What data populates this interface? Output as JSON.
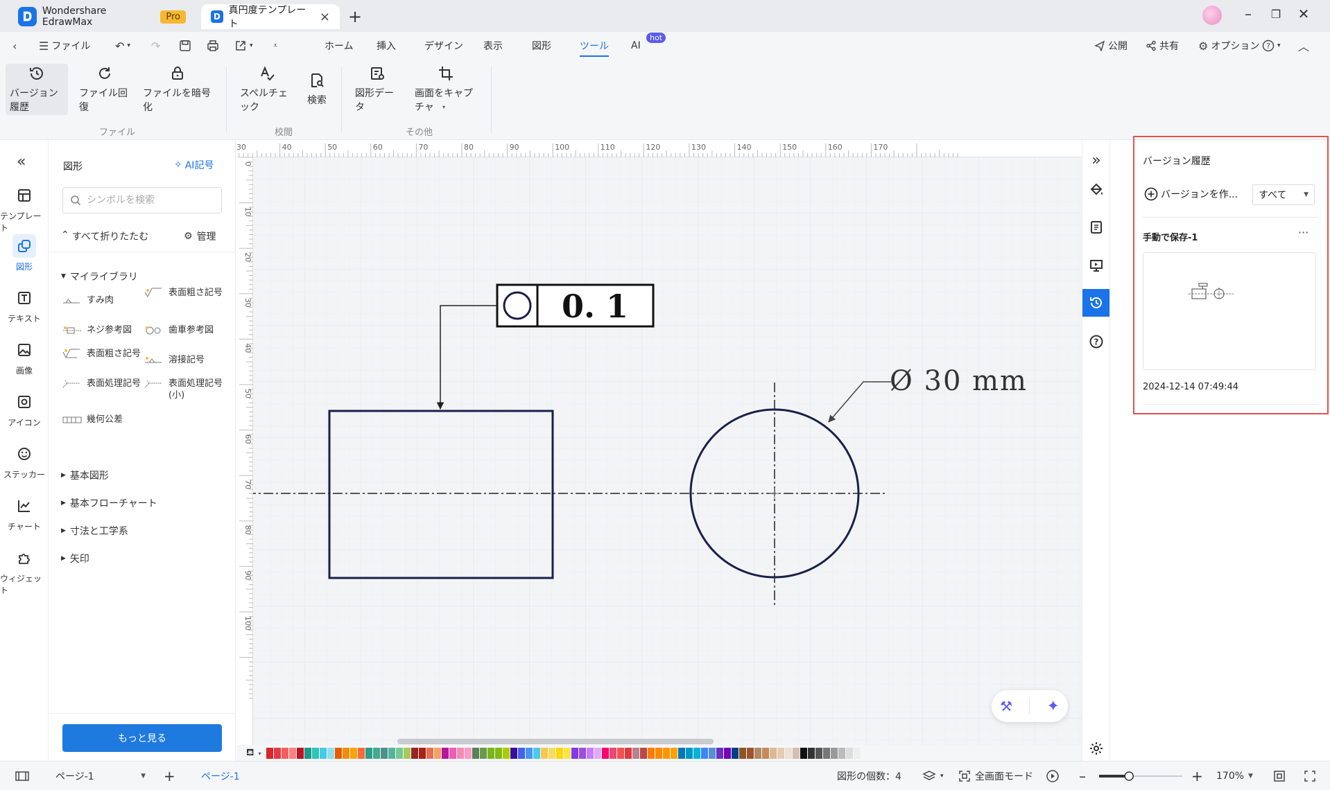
{
  "titlebar": {
    "app_name": "Wondershare EdrawMax",
    "pro_badge": "Pro",
    "doc_tab": "真円度テンプレート",
    "doc_icon": "D"
  },
  "menubar": {
    "file": "ファイル",
    "tabs": [
      "ホーム",
      "挿入",
      "デザイン",
      "表示",
      "図形",
      "ツール",
      "AI"
    ],
    "active_tab": "ツール",
    "hot_badge": "hot",
    "publish": "公開",
    "share": "共有",
    "options": "オプション"
  },
  "ribbon": {
    "buttons": [
      "バージョン履歴",
      "ファイル回復",
      "ファイルを暗号化",
      "スペルチェック",
      "検索",
      "図形データ",
      "画面をキャプチャ"
    ],
    "groups": [
      "ファイル",
      "校閲",
      "その他"
    ]
  },
  "leftnav": {
    "items": [
      "テンプレート",
      "図形",
      "テキスト",
      "画像",
      "アイコン",
      "ステッカー",
      "チャート",
      "ウィジェット"
    ],
    "active": "図形"
  },
  "library": {
    "title": "図形",
    "ai_symbol": "AI記号",
    "search_placeholder": "シンボルを検索",
    "collapse_all": "すべて折りたたむ",
    "manage": "管理",
    "my_library": "マイライブラリ",
    "symbols": [
      "すみ肉",
      "表面粗さ記号",
      "ネジ参考図",
      "歯車参考図",
      "表面粗さ記号",
      "溶接記号",
      "表面処理記号",
      "表面処理記号(小)",
      "幾何公差"
    ],
    "sections": [
      "基本図形",
      "基本フローチャート",
      "寸法と工学系",
      "矢印"
    ],
    "more_button": "もっと見る"
  },
  "ruler": {
    "h_ticks": [
      "30",
      "40",
      "50",
      "60",
      "70",
      "80",
      "90",
      "100",
      "110",
      "120",
      "130",
      "140",
      "150",
      "160",
      "170"
    ],
    "v_ticks": [
      "0",
      "10",
      "20",
      "30",
      "40",
      "50",
      "60",
      "70",
      "80",
      "90",
      "100"
    ]
  },
  "drawing": {
    "tolerance_value": "0. 1",
    "diameter_label": "Ø 30 mm"
  },
  "version_panel": {
    "title": "バージョン履歴",
    "create": "バージョンを作...",
    "filter": "すべて",
    "entry_title": "手動で保存-1",
    "entry_date": "2024-12-14 07:49:44"
  },
  "statusbar": {
    "page_select": "ページ-1",
    "page_tab": "ページ-1",
    "shape_count": "図形の個数：4",
    "fullscreen": "全画面モード",
    "zoom": "170%",
    "zoom_level": 0.36
  },
  "colors": {
    "accent": "#1a73e8",
    "highlight": "#e0524f",
    "drawing_stroke": "#1a1f4a",
    "palette": [
      "#d62828",
      "#e63946",
      "#f25f5c",
      "#f28482",
      "#c1121f",
      "#1b998b",
      "#2ec4b6",
      "#48cae4",
      "#90e0ef",
      "#e85d04",
      "#f48c06",
      "#faa307",
      "#ff6b35",
      "#2a9d8f",
      "#43aa8b",
      "#4d908e",
      "#52b69a",
      "#76c893",
      "#a7c957",
      "#9b2226",
      "#ae2012",
      "#e76f51",
      "#f4a261",
      "#b5179e",
      "#f15bb5",
      "#f28cb1",
      "#ff99c8",
      "#588157",
      "#6a994e",
      "#7cb518",
      "#80b918",
      "#aacc00",
      "#3a0ca3",
      "#4361ee",
      "#4895ef",
      "#4cc9f0",
      "#f9c74f",
      "#f9dc5c",
      "#ffd60a",
      "#fee440",
      "#8338ec",
      "#9d4edd",
      "#c77dff",
      "#e0aaff",
      "#ff006e",
      "#ef476f",
      "#f15152",
      "#e5383b",
      "#b5838d",
      "#bc4749",
      "#ff7b00",
      "#ff8800",
      "#ff9500",
      "#ffa200",
      "#0077b6",
      "#0096c7",
      "#00b4d8",
      "#3a86ff",
      "#5390d9",
      "#6930c3",
      "#7400b8",
      "#023e8a",
      "#8d5524",
      "#a0522d",
      "#b08968",
      "#c68b59",
      "#ddb892",
      "#e6ccb2",
      "#ede0d4",
      "#d5bdaf",
      "#111111",
      "#333333",
      "#555555",
      "#777777",
      "#999999",
      "#bbbbbb",
      "#dddddd",
      "#eeeeee"
    ]
  }
}
